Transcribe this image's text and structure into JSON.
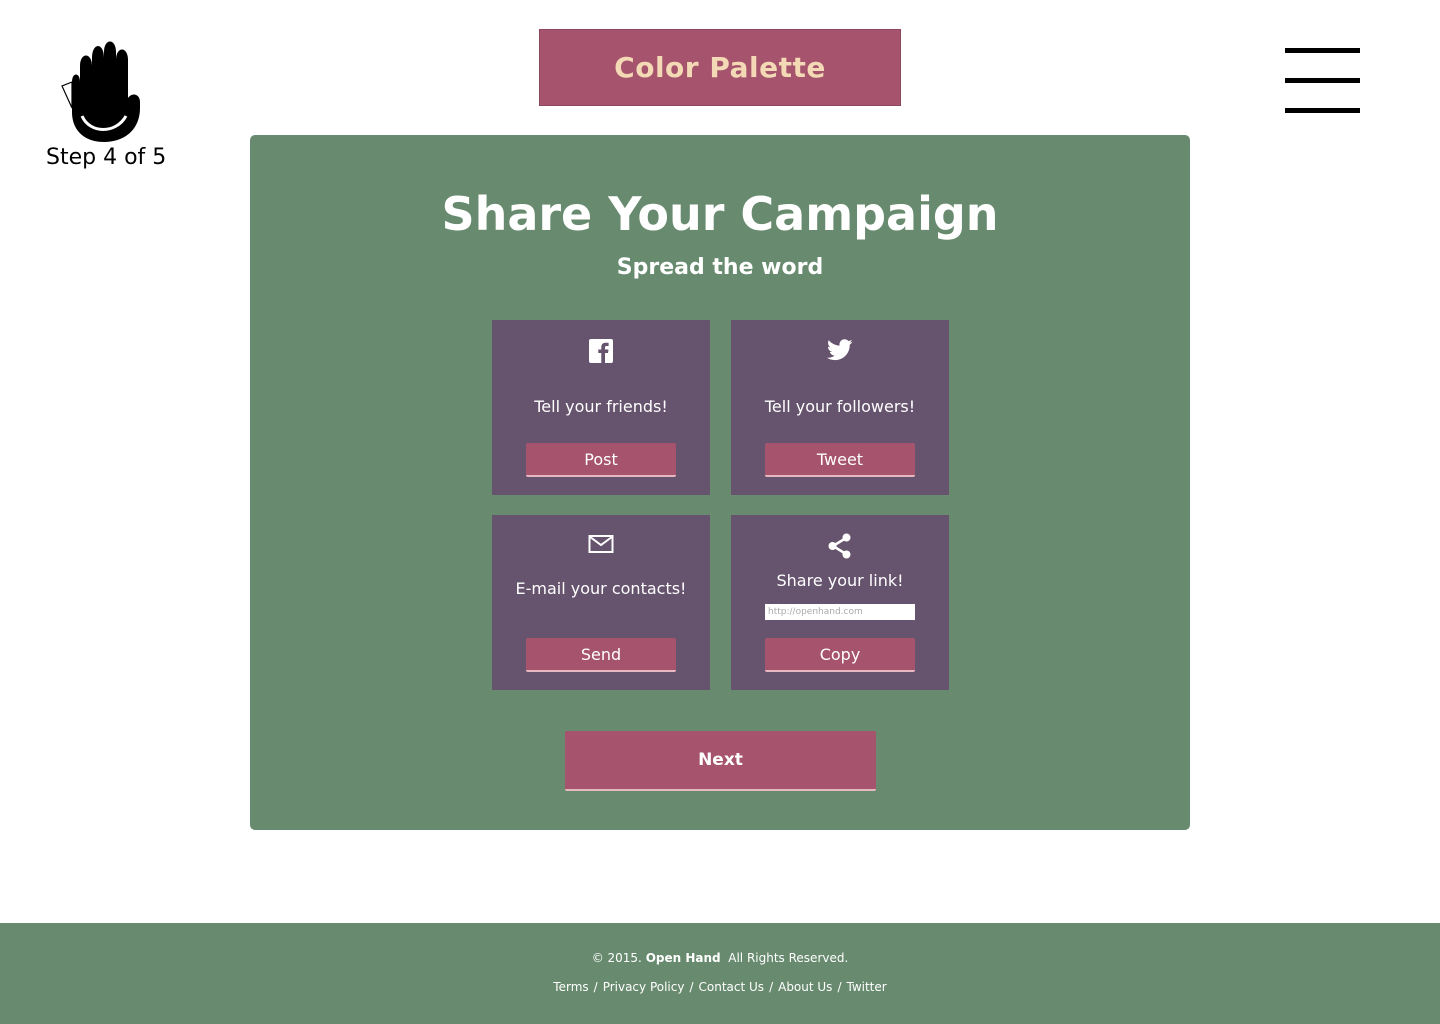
{
  "header": {
    "step_label": "Step 4 of 5",
    "palette_label": "Color Palette",
    "logo_icon": "hand-logo-icon",
    "menu_icon": "hamburger-menu-icon"
  },
  "panel": {
    "title": "Share Your Campaign",
    "subtitle": "Spread the word",
    "cards": [
      {
        "icon": "facebook-icon",
        "text": "Tell your friends!",
        "button": "Post"
      },
      {
        "icon": "twitter-icon",
        "text": "Tell your followers!",
        "button": "Tweet"
      },
      {
        "icon": "mail-icon",
        "text": "E-mail your contacts!",
        "button": "Send"
      },
      {
        "icon": "share-icon",
        "text": "Share your link!",
        "link_placeholder": "http://openhand.com",
        "button": "Copy"
      }
    ],
    "next_label": "Next"
  },
  "footer": {
    "copyright_prefix": "© 2015.",
    "brand": "Open Hand",
    "copyright_suffix": "All Rights Reserved.",
    "links": [
      "Terms",
      "Privacy Policy",
      "Contact Us",
      "About Us",
      "Twitter"
    ]
  },
  "colors": {
    "panel_green": "#688b6f",
    "card_purple": "#66536d",
    "button_rose": "#a6536d",
    "palette_text": "#f3d9b5"
  }
}
